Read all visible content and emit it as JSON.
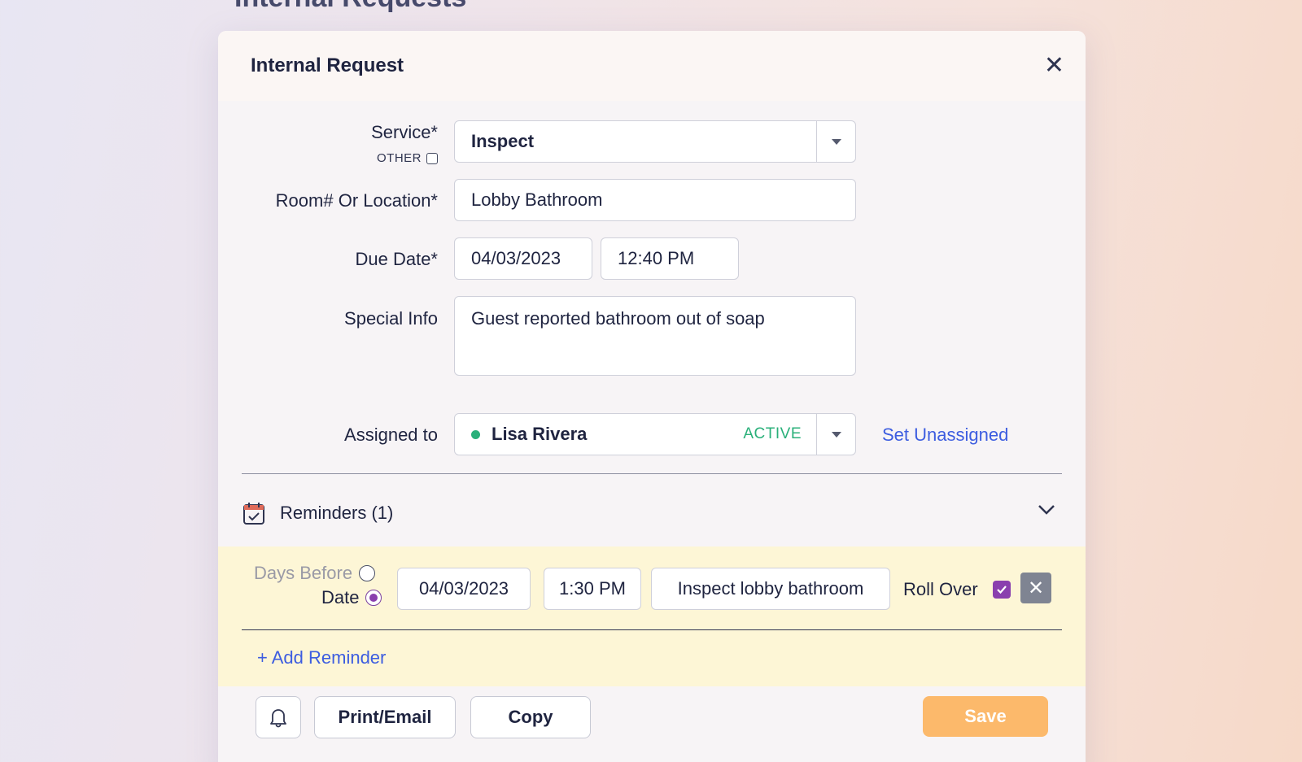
{
  "page": {
    "background_title": "Internal Requests"
  },
  "modal": {
    "title": "Internal Request",
    "close_icon": "close-icon"
  },
  "form": {
    "service_label": "Service*",
    "service_value": "Inspect",
    "other_label": "OTHER",
    "other_checked": false,
    "location_label": "Room# Or Location*",
    "location_value": "Lobby Bathroom",
    "due_label": "Due Date*",
    "due_date": "04/03/2023",
    "due_time": "12:40 PM",
    "special_label": "Special Info",
    "special_value": "Guest reported bathroom out of soap",
    "assigned_label": "Assigned to",
    "assignee_name": "Lisa Rivera",
    "assignee_status": "ACTIVE",
    "assignee_status_color": "#2ab07a",
    "set_unassigned": "Set Unassigned"
  },
  "reminders": {
    "header": "Reminders (1)",
    "icon": "calendar-check-icon",
    "items": [
      {
        "option_days_before": "Days Before",
        "option_date": "Date",
        "selected": "Date",
        "date": "04/03/2023",
        "time": "1:30 PM",
        "text": "Inspect lobby bathroom",
        "rollover_label": "Roll Over",
        "rollover_checked": true
      }
    ],
    "add_label": "+ Add Reminder"
  },
  "footer": {
    "bell_icon": "bell-icon",
    "print_email": "Print/Email",
    "copy": "Copy",
    "save": "Save"
  },
  "colors": {
    "accent_link": "#3d5de0",
    "save": "#fcb96b",
    "reminder_bg": "#fdf6d6",
    "checkbox": "#8a3fae"
  }
}
